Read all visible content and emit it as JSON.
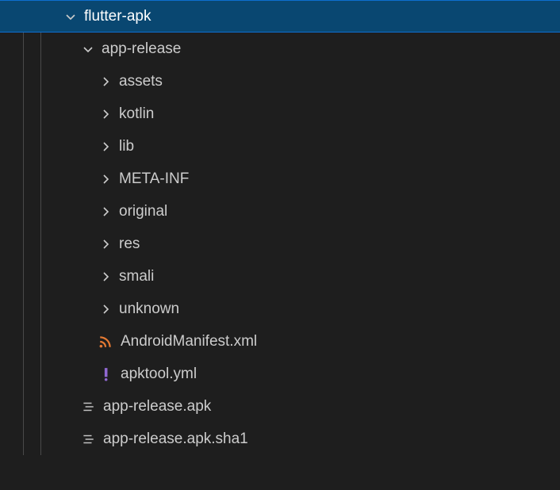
{
  "colors": {
    "bg": "#1e1e1e",
    "fg": "#cccccc",
    "selectedBg": "#094771",
    "selectedBorder": "#0d6fd0",
    "rssIcon": "#e37933",
    "yamlIcon": "#9068d1",
    "fileIcon": "#c5c5c5"
  },
  "tree": {
    "root": {
      "name": "flutter-apk",
      "type": "folder",
      "expanded": true,
      "selected": true,
      "children": [
        {
          "name": "app-release",
          "type": "folder",
          "expanded": true,
          "children": [
            {
              "name": "assets",
              "type": "folder",
              "expanded": false
            },
            {
              "name": "kotlin",
              "type": "folder",
              "expanded": false
            },
            {
              "name": "lib",
              "type": "folder",
              "expanded": false
            },
            {
              "name": "META-INF",
              "type": "folder",
              "expanded": false
            },
            {
              "name": "original",
              "type": "folder",
              "expanded": false
            },
            {
              "name": "res",
              "type": "folder",
              "expanded": false
            },
            {
              "name": "smali",
              "type": "folder",
              "expanded": false
            },
            {
              "name": "unknown",
              "type": "folder",
              "expanded": false
            },
            {
              "name": "AndroidManifest.xml",
              "type": "file",
              "icon": "rss"
            },
            {
              "name": "apktool.yml",
              "type": "file",
              "icon": "yaml"
            }
          ]
        },
        {
          "name": "app-release.apk",
          "type": "file",
          "icon": "lines"
        },
        {
          "name": "app-release.apk.sha1",
          "type": "file",
          "icon": "lines"
        }
      ]
    }
  }
}
